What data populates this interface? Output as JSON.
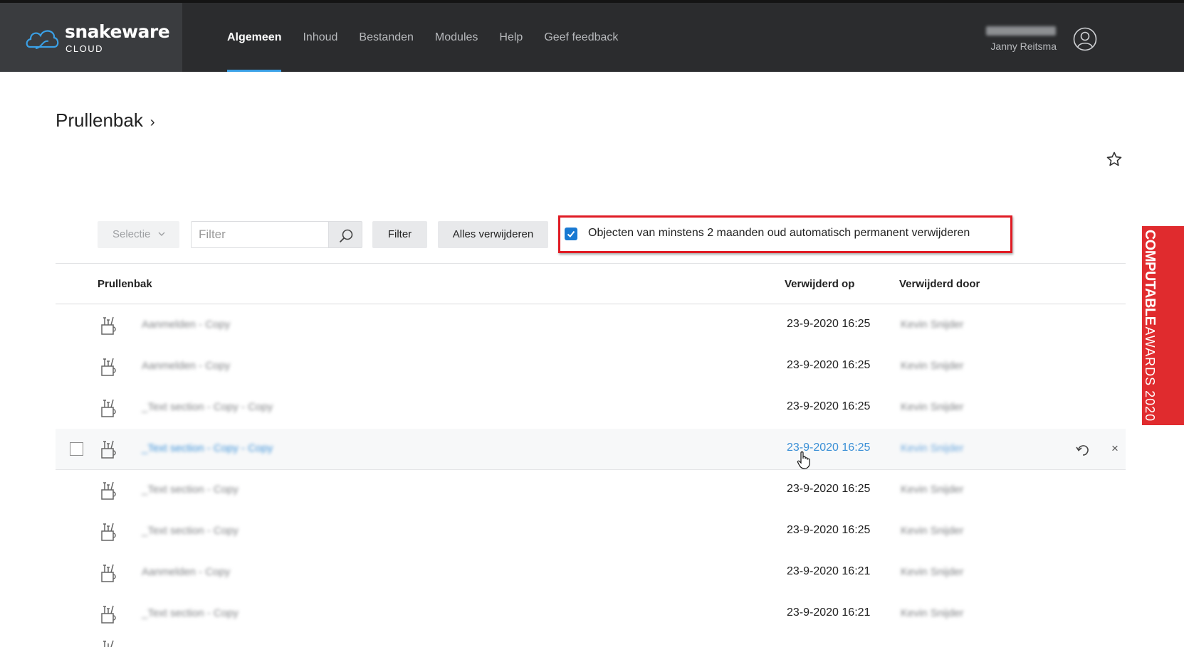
{
  "brand": {
    "name": "snakeware",
    "sub": "CLOUD"
  },
  "nav": {
    "items": [
      {
        "label": "Algemeen",
        "active": true
      },
      {
        "label": "Inhoud"
      },
      {
        "label": "Bestanden"
      },
      {
        "label": "Modules"
      },
      {
        "label": "Help"
      },
      {
        "label": "Geef feedback"
      }
    ]
  },
  "user": {
    "code": "XXXXXXXXXX",
    "name": "Janny Reitsma"
  },
  "page": {
    "title": "Prullenbak",
    "chevron": "›"
  },
  "toolbar": {
    "selection_label": "Selectie",
    "filter_placeholder": "Filter",
    "filter_button": "Filter",
    "delete_all_button": "Alles verwijderen",
    "auto_delete_checked": true,
    "auto_delete_label": "Objecten van minstens 2 maanden oud automatisch permanent verwijderen"
  },
  "table": {
    "headers": {
      "name": "Prullenbak",
      "deleted_on": "Verwijderd op",
      "deleted_by": "Verwijderd door"
    },
    "rows": [
      {
        "name": "Aanmelden - Copy",
        "deleted_on": "23-9-2020 16:25",
        "deleted_by": "Kevin Snijder"
      },
      {
        "name": "Aanmelden - Copy",
        "deleted_on": "23-9-2020 16:25",
        "deleted_by": "Kevin Snijder"
      },
      {
        "name": "_Text section - Copy - Copy",
        "deleted_on": "23-9-2020 16:25",
        "deleted_by": "Kevin Snijder"
      },
      {
        "name": "_Text section - Copy - Copy",
        "deleted_on": "23-9-2020 16:25",
        "deleted_by": "Kevin Snijder"
      },
      {
        "name": "_Text section - Copy",
        "deleted_on": "23-9-2020 16:25",
        "deleted_by": "Kevin Snijder"
      },
      {
        "name": "_Text section - Copy",
        "deleted_on": "23-9-2020 16:25",
        "deleted_by": "Kevin Snijder"
      },
      {
        "name": "Aanmelden - Copy",
        "deleted_on": "23-9-2020 16:21",
        "deleted_by": "Kevin Snijder"
      },
      {
        "name": "_Text section - Copy",
        "deleted_on": "23-9-2020 16:21",
        "deleted_by": "Kevin Snijder"
      }
    ],
    "row_actions": {
      "delete_symbol": "×"
    }
  },
  "award": {
    "brand": "COMPUTABLE",
    "year": "AWARDS 2020"
  },
  "colors": {
    "topbar": "#2b2c2e",
    "accent": "#3aa0e6",
    "checkbox": "#1979d2",
    "highlight": "#e01b24",
    "award": "#e02b2e"
  }
}
